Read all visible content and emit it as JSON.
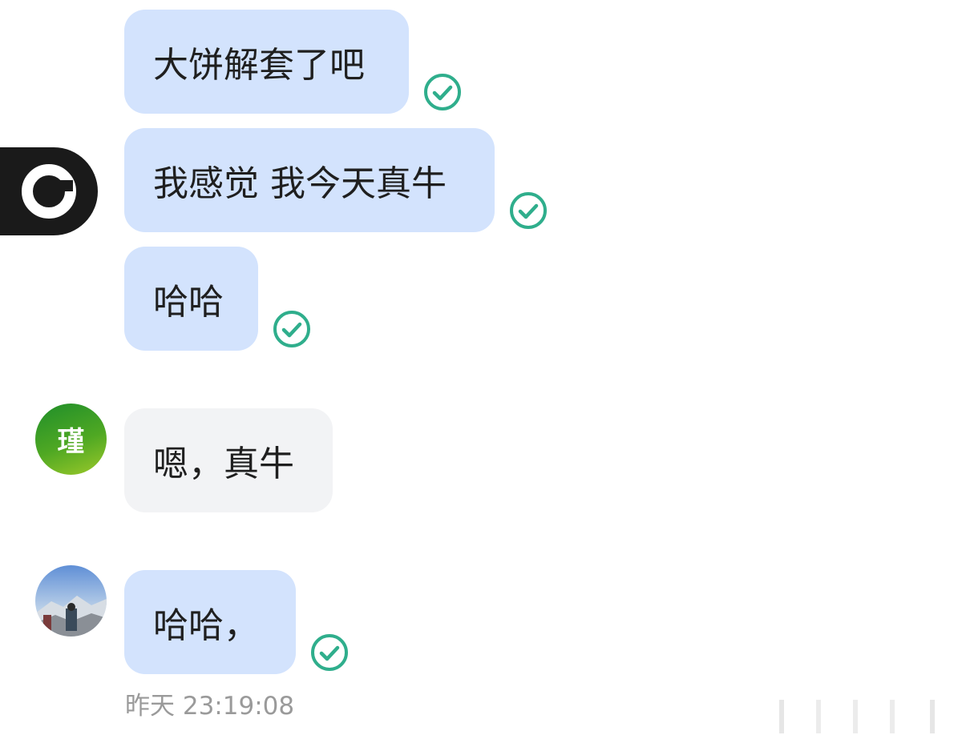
{
  "messages": [
    {
      "text": "大饼解套了吧",
      "direction": "sent",
      "status": "delivered"
    },
    {
      "text": "我感觉 我今天真牛",
      "direction": "sent",
      "status": "delivered"
    },
    {
      "text": "哈哈",
      "direction": "sent",
      "status": "delivered"
    },
    {
      "text": "嗯，真牛",
      "direction": "received"
    },
    {
      "text": "哈哈，",
      "direction": "sent",
      "status": "delivered"
    }
  ],
  "contacts": {
    "peer_avatar_text": "瑾"
  },
  "footer": {
    "timestamp": "昨天 23:19:08"
  },
  "colors": {
    "sent_bubble": "#d3e3fd",
    "received_bubble": "#f2f3f5",
    "check_accent": "#2fae8c",
    "peer_avatar": "#3d9b24"
  },
  "icons": {
    "delivered": "check-circle-icon",
    "overlay": "app-logo-icon"
  }
}
